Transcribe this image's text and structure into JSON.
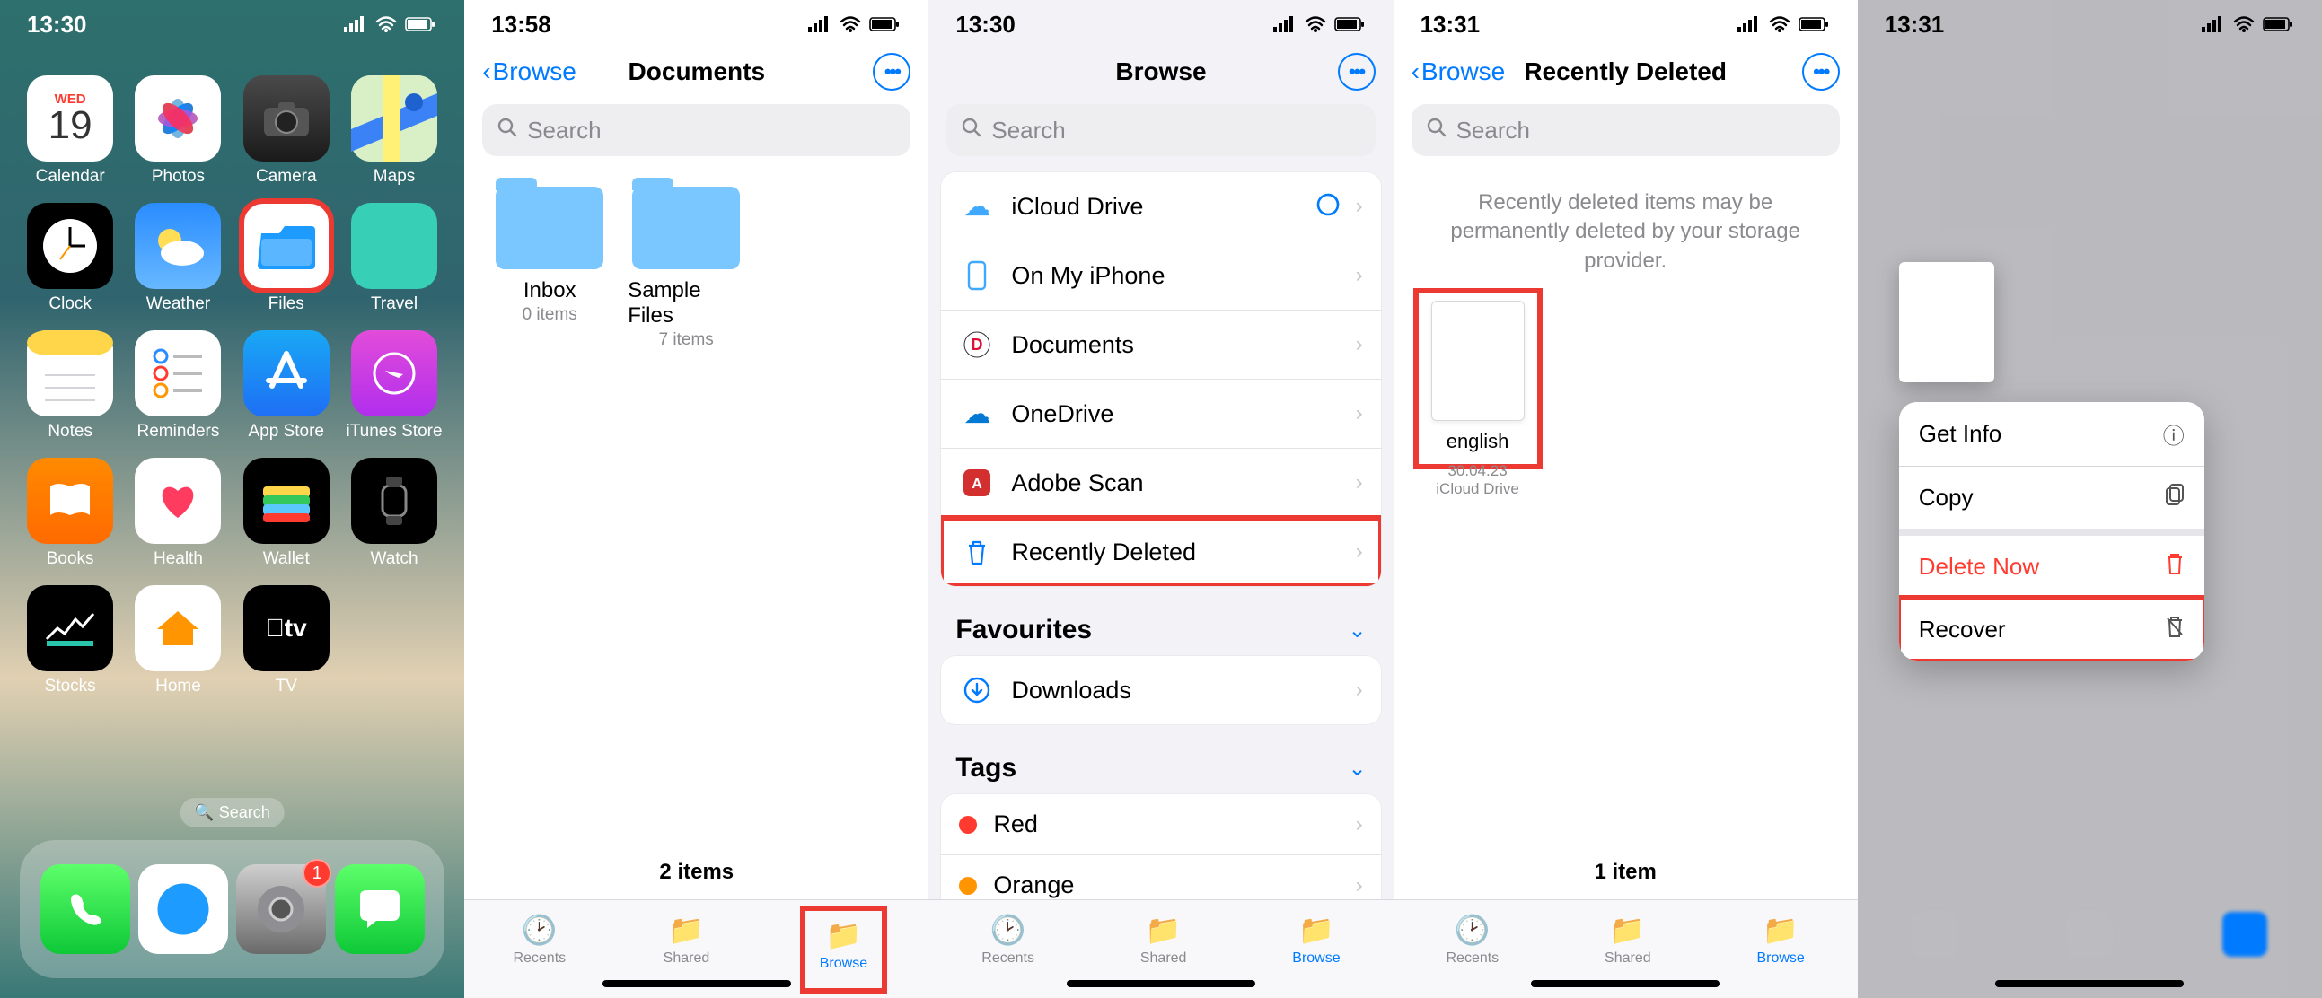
{
  "colors": {
    "accent": "#007aff",
    "danger": "#ff3b30",
    "highlight": "#ec3a32"
  },
  "screen1": {
    "time": "13:30",
    "calendar_day_name": "WED",
    "calendar_day_num": "19",
    "apps": {
      "calendar": "Calendar",
      "photos": "Photos",
      "camera": "Camera",
      "maps": "Maps",
      "clock": "Clock",
      "weather": "Weather",
      "files": "Files",
      "travel": "Travel",
      "notes": "Notes",
      "reminders": "Reminders",
      "appstore": "App Store",
      "itunes": "iTunes Store",
      "books": "Books",
      "health": "Health",
      "wallet": "Wallet",
      "watch": "Watch",
      "stocks": "Stocks",
      "home": "Home",
      "tv": "TV"
    },
    "search_pill": "Search",
    "settings_badge": "1"
  },
  "screen2": {
    "time": "13:58",
    "back": "Browse",
    "title": "Documents",
    "search_placeholder": "Search",
    "folders": [
      {
        "name": "Inbox",
        "sub": "0 items"
      },
      {
        "name": "Sample Files",
        "sub": "7 items"
      }
    ],
    "count": "2 items",
    "tabs": {
      "recents": "Recents",
      "shared": "Shared",
      "browse": "Browse"
    }
  },
  "screen3": {
    "time": "13:30",
    "title": "Browse",
    "search_placeholder": "Search",
    "locations": [
      {
        "icon": "icloud",
        "label": "iCloud Drive",
        "trailing": "progress"
      },
      {
        "icon": "phone",
        "label": "On My iPhone"
      },
      {
        "icon": "docs",
        "label": "Documents"
      },
      {
        "icon": "onedrive",
        "label": "OneDrive"
      },
      {
        "icon": "adobe",
        "label": "Adobe Scan"
      },
      {
        "icon": "trash",
        "label": "Recently Deleted",
        "highlight": true
      }
    ],
    "fav_header": "Favourites",
    "favs": [
      {
        "icon": "download",
        "label": "Downloads"
      }
    ],
    "tags_header": "Tags",
    "tags": [
      {
        "color": "#ff3b30",
        "label": "Red"
      },
      {
        "color": "#ff9500",
        "label": "Orange"
      }
    ]
  },
  "screen4": {
    "time": "13:31",
    "back": "Browse",
    "title": "Recently Deleted",
    "search_placeholder": "Search",
    "note": "Recently deleted items may be permanently deleted by your storage provider.",
    "file": {
      "name": "english",
      "date": "30.04.23",
      "location": "iCloud Drive"
    },
    "count": "1 item"
  },
  "screen5": {
    "time": "13:31",
    "menu": {
      "get_info": "Get Info",
      "copy": "Copy",
      "delete_now": "Delete Now",
      "recover": "Recover"
    }
  }
}
